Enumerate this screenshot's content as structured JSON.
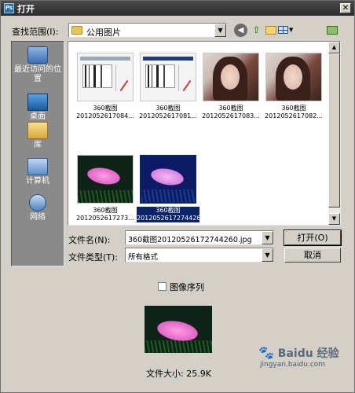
{
  "window": {
    "title": "打开",
    "app_icon_text": "Ps",
    "close_symbol": "✕"
  },
  "toolbar": {
    "look_in_label": "查找范围(I):",
    "look_in_value": "公用图片",
    "icons": [
      "back-icon",
      "up-folder-icon",
      "new-folder-icon",
      "view-menu-icon",
      "go-right-icon"
    ]
  },
  "places": [
    {
      "label": "最近访问的位置",
      "icon": "recent-places-icon"
    },
    {
      "label": "桌面",
      "icon": "desktop-icon"
    },
    {
      "label": "库",
      "icon": "libraries-icon"
    },
    {
      "label": "计算机",
      "icon": "computer-icon"
    },
    {
      "label": "网络",
      "icon": "network-icon"
    }
  ],
  "files": [
    {
      "name": "360截图\n2012052617084...",
      "kind": "screenshot"
    },
    {
      "name": "360截图\n2012052617081...",
      "kind": "screenshot"
    },
    {
      "name": "360截图\n2012052617083...",
      "kind": "photo"
    },
    {
      "name": "360截图\n2012052617082...",
      "kind": "photo"
    },
    {
      "name": "360截图\n2012052617273...",
      "kind": "fish"
    },
    {
      "name": "360截图\n20120526172744260.jpg",
      "kind": "fish-blue",
      "selected": true
    }
  ],
  "form": {
    "file_name_label": "文件名(N):",
    "file_name_value": "360截图20120526172744260.jpg",
    "file_type_label": "文件类型(T):",
    "file_type_value": "所有格式",
    "image_sequence_label": "图像序列",
    "image_sequence_checked": false
  },
  "buttons": {
    "open": "打开(O)",
    "cancel": "取消"
  },
  "preview": {
    "file_size": "文件大小: 25.9K"
  },
  "watermark": {
    "brand": "Baidu 经验",
    "url": "jingyan.baidu.com"
  },
  "colors": {
    "selection": "#0a246a",
    "dialog_bg": "#d4d0c8",
    "places_bg": "#8a8a8a"
  }
}
